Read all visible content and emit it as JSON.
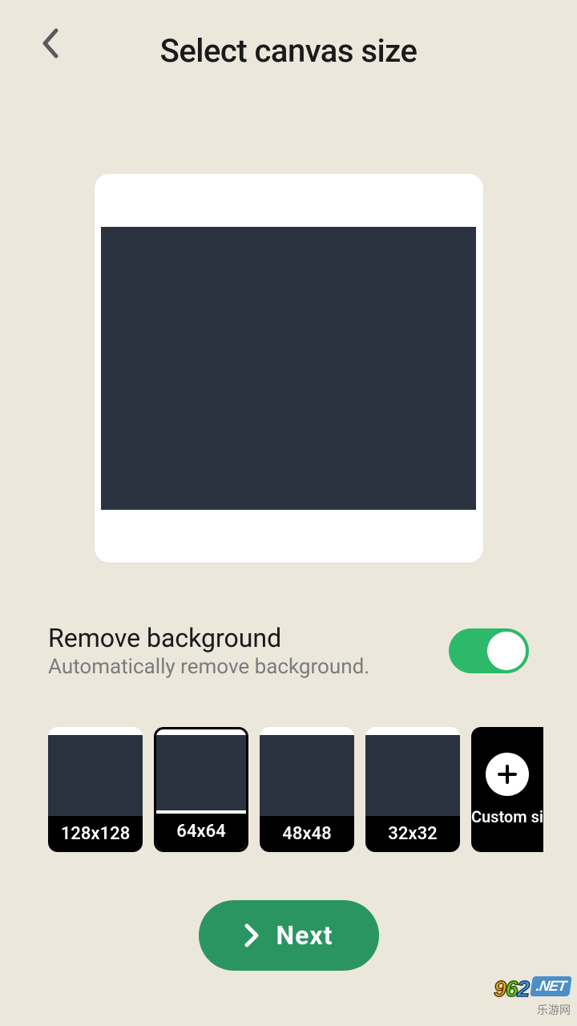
{
  "header": {
    "title": "Select canvas size"
  },
  "removeBg": {
    "title": "Remove background",
    "subtitle": "Automatically remove background.",
    "enabled": true
  },
  "sizes": [
    {
      "label": "128x128",
      "selected": false
    },
    {
      "label": "64x64",
      "selected": true
    },
    {
      "label": "48x48",
      "selected": false
    },
    {
      "label": "32x32",
      "selected": false
    }
  ],
  "customSize": {
    "label": "Custom si"
  },
  "nextButton": {
    "label": "Next"
  },
  "watermark": {
    "d1": "9",
    "d2": "6",
    "d3": "2",
    "net": ".NET",
    "sub": "乐游网"
  }
}
